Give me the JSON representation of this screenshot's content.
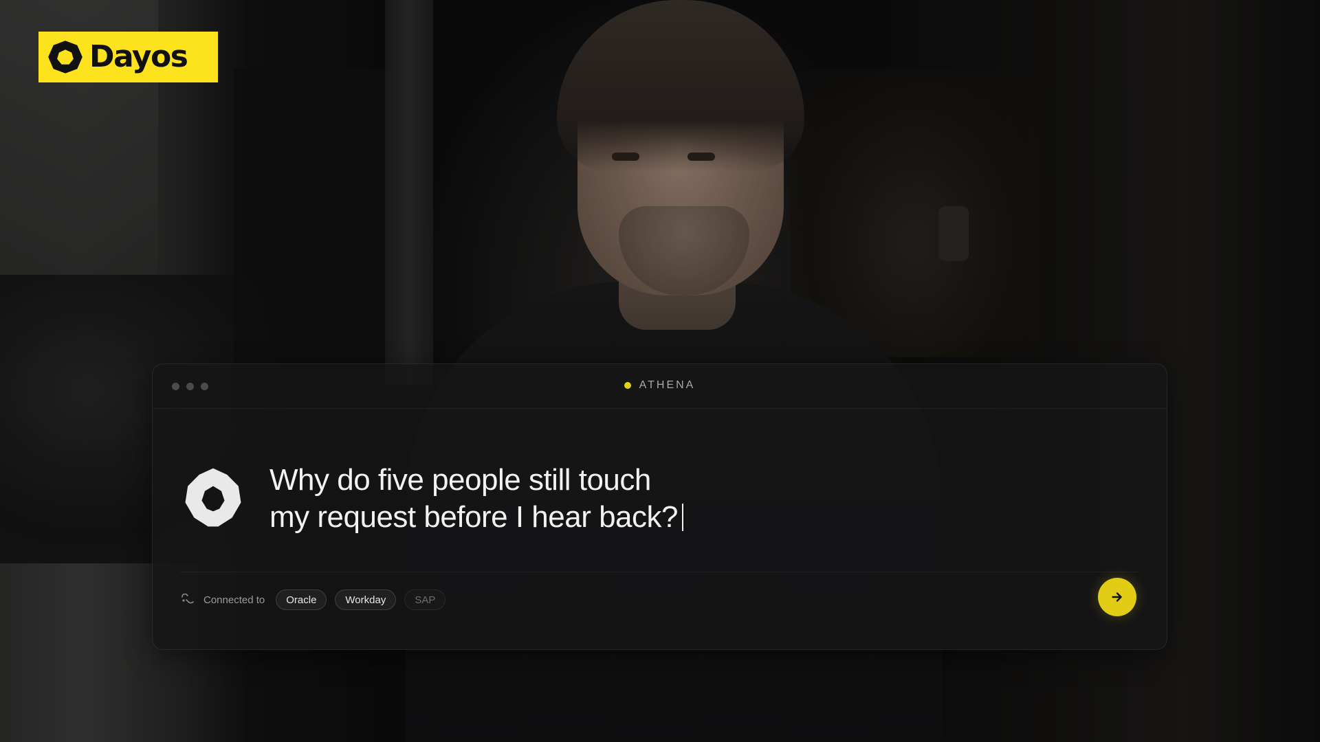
{
  "brand": {
    "name": "Dayos",
    "accent_color": "#fde31e"
  },
  "panel": {
    "agent_name": "ATHENA",
    "agent_status_color": "#e6cf17",
    "query_lines": [
      "Why do five people still touch",
      "my request before I hear back?"
    ],
    "connected_label": "Connected to",
    "integrations": [
      {
        "label": "Oracle",
        "state": "active"
      },
      {
        "label": "Workday",
        "state": "active"
      },
      {
        "label": "SAP",
        "state": "inactive"
      }
    ],
    "send_icon": "arrow-right-icon"
  }
}
